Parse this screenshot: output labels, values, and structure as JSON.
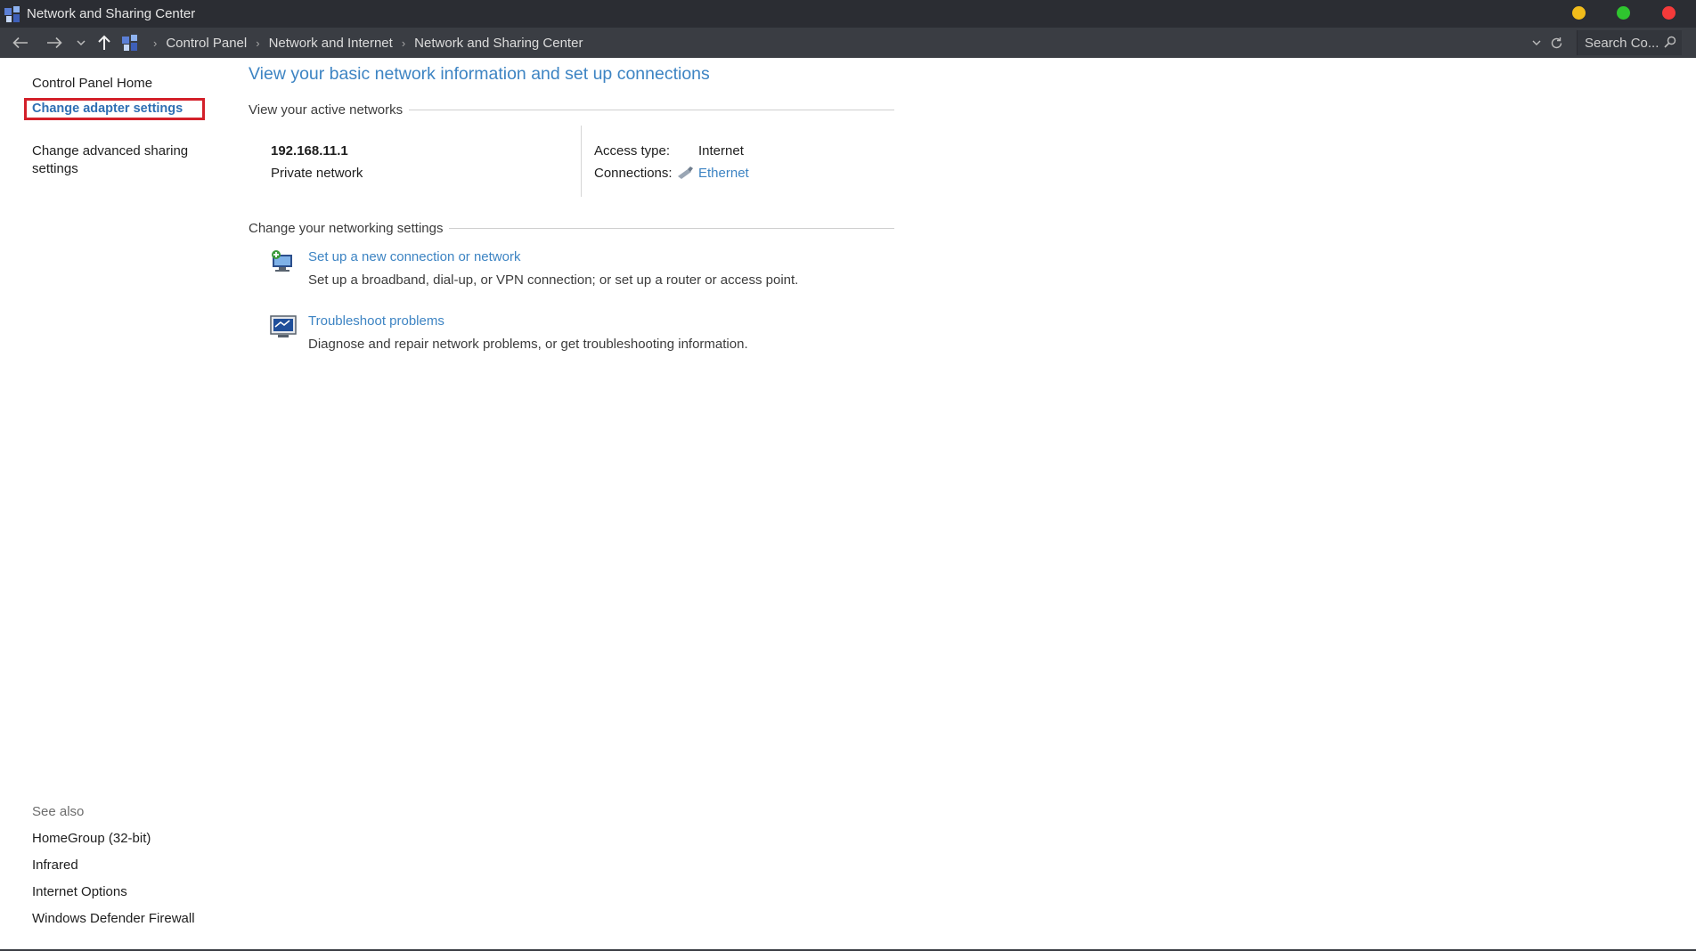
{
  "window": {
    "title": "Network and Sharing Center",
    "icon": "control-panel-icon",
    "controls": {
      "minimize_color": "#f1bc1b",
      "maximize_color": "#2fc52f",
      "close_color": "#f43a3a"
    }
  },
  "addressbar": {
    "breadcrumbs": [
      "Control Panel",
      "Network and Internet",
      "Network and Sharing Center"
    ],
    "search_placeholder": "Search Co...",
    "icons": [
      "back-arrow-icon",
      "forward-arrow-icon",
      "chevron-down-icon",
      "up-arrow-icon",
      "control-panel-icon",
      "refresh-icon",
      "search-icon"
    ]
  },
  "sidebar": {
    "home": "Control Panel Home",
    "tasks": [
      "Change adapter settings",
      "Change advanced sharing settings"
    ],
    "highlight_color": "#d3202a",
    "see_also_heading": "See also",
    "see_also": [
      "HomeGroup (32-bit)",
      "Infrared",
      "Internet Options",
      "Windows Defender Firewall"
    ]
  },
  "main": {
    "title": "View your basic network information and set up connections",
    "active_networks_heading": "View your active networks",
    "network": {
      "name": "192.168.11.1",
      "category": "Private network",
      "access_type_label": "Access type:",
      "access_type_value": "Internet",
      "connections_label": "Connections:",
      "connections_value": "Ethernet"
    },
    "settings_heading": "Change your networking settings",
    "tasks": [
      {
        "icon": "new-connection-icon",
        "link": "Set up a new connection or network",
        "description": "Set up a broadband, dial-up, or VPN connection; or set up a router or access point."
      },
      {
        "icon": "troubleshoot-icon",
        "link": "Troubleshoot problems",
        "description": "Diagnose and repair network problems, or get troubleshooting information."
      }
    ],
    "link_color": "#3d84c3"
  }
}
